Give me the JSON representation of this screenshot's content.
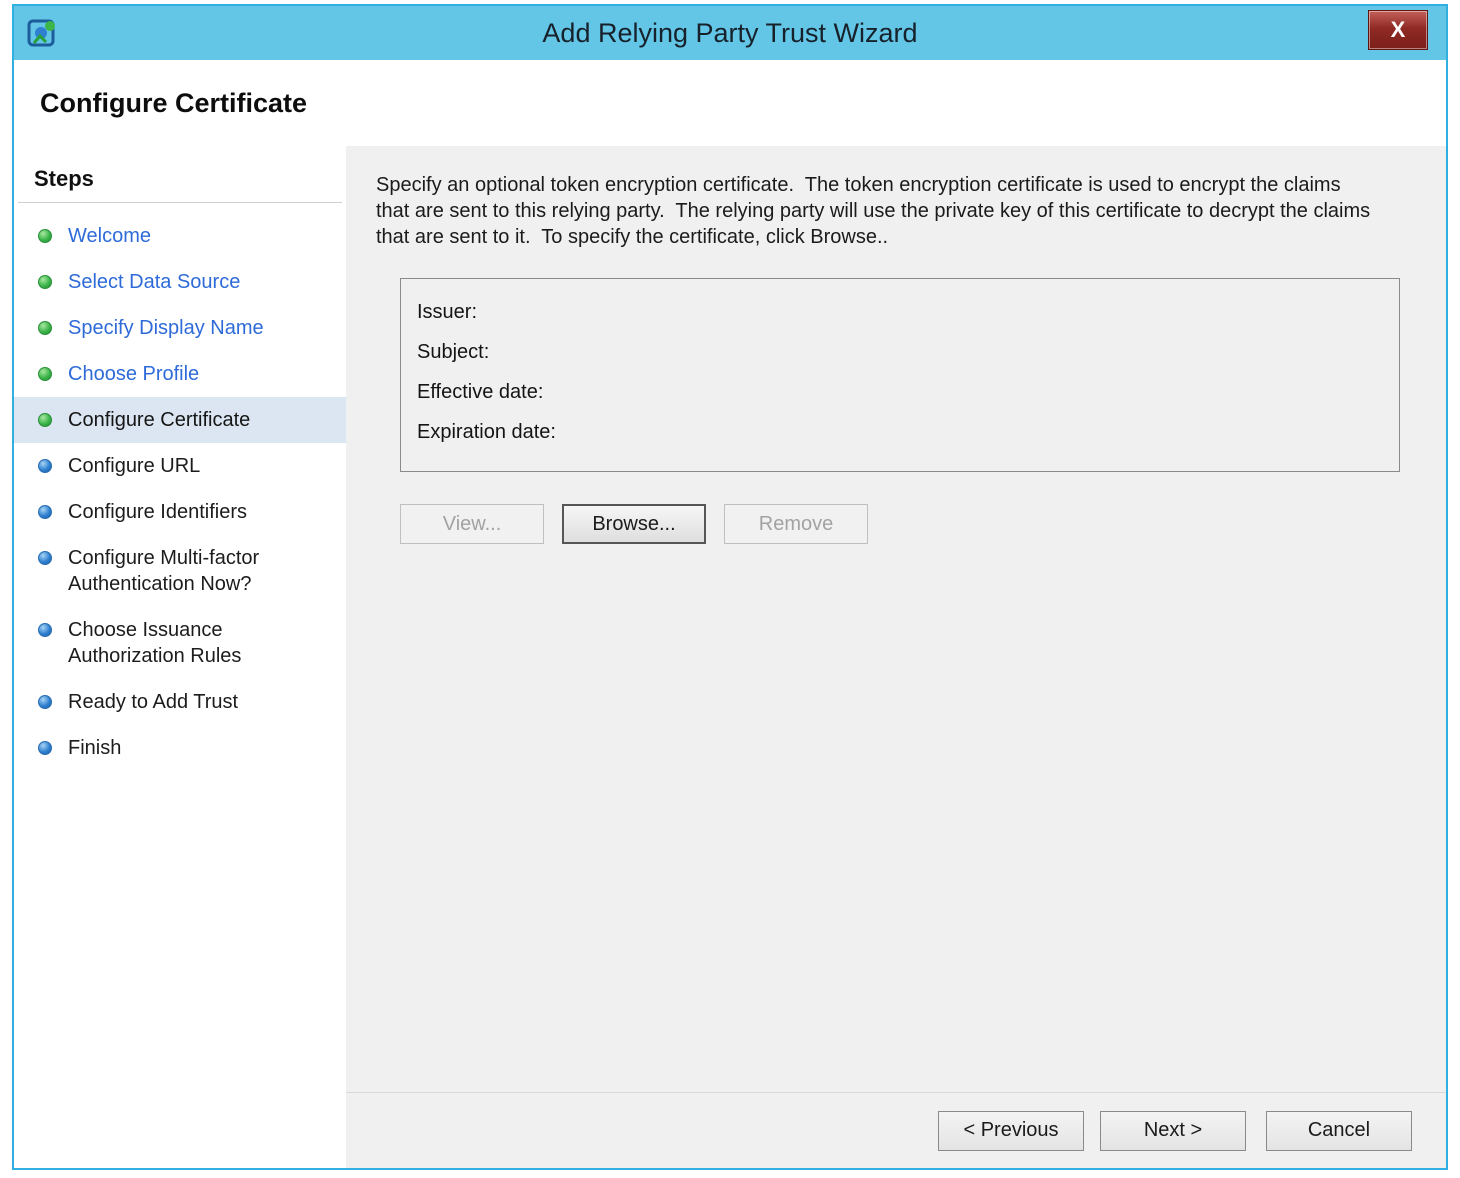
{
  "window": {
    "title": "Add Relying Party Trust Wizard",
    "close_label": "X",
    "heading": "Configure Certificate"
  },
  "steps": {
    "title": "Steps",
    "items": [
      {
        "label": "Welcome",
        "state": "done",
        "link": true
      },
      {
        "label": "Select Data Source",
        "state": "done",
        "link": true
      },
      {
        "label": "Specify Display Name",
        "state": "done",
        "link": true
      },
      {
        "label": "Choose Profile",
        "state": "done",
        "link": true
      },
      {
        "label": "Configure Certificate",
        "state": "current",
        "link": false
      },
      {
        "label": "Configure URL",
        "state": "todo",
        "link": false
      },
      {
        "label": "Configure Identifiers",
        "state": "todo",
        "link": false
      },
      {
        "label": "Configure Multi-factor Authentication Now?",
        "state": "todo",
        "link": false
      },
      {
        "label": "Choose Issuance Authorization Rules",
        "state": "todo",
        "link": false
      },
      {
        "label": "Ready to Add Trust",
        "state": "todo",
        "link": false
      },
      {
        "label": "Finish",
        "state": "todo",
        "link": false
      }
    ]
  },
  "content": {
    "description": "Specify an optional token encryption certificate.  The token encryption certificate is used to encrypt the claims that are sent to this relying party.  The relying party will use the private key of this certificate to decrypt the claims that are sent to it.  To specify the certificate, click Browse..",
    "certificate_fields": [
      {
        "label": "Issuer:",
        "value": ""
      },
      {
        "label": "Subject:",
        "value": ""
      },
      {
        "label": "Effective date:",
        "value": ""
      },
      {
        "label": "Expiration date:",
        "value": ""
      }
    ],
    "buttons": {
      "view": "View...",
      "browse": "Browse...",
      "remove": "Remove"
    }
  },
  "footer": {
    "previous": "< Previous",
    "next": "Next >",
    "cancel": "Cancel"
  },
  "colors": {
    "titlebar": "#63c6e6",
    "window_border": "#2fb0e0",
    "link_blue": "#2e6bd8",
    "done_bullet_green": "#3cb54a",
    "todo_bullet_blue": "#2f80d0",
    "current_step_highlight": "#dbe6f2",
    "content_background": "#f0f0f0",
    "close_button_red": "#8f2a24"
  }
}
